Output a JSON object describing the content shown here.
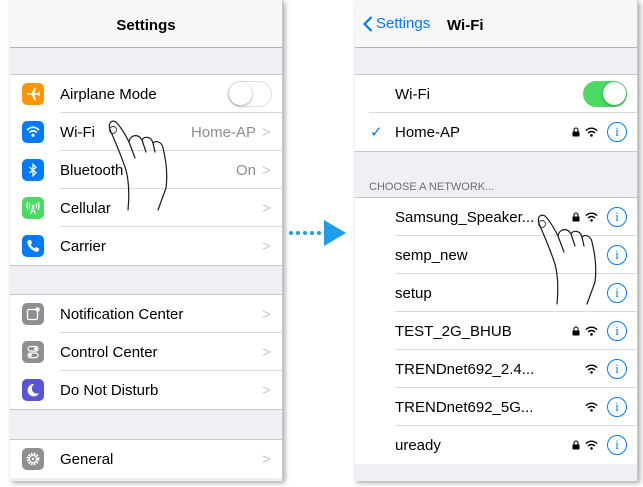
{
  "left": {
    "nav_title": "Settings",
    "rows": [
      {
        "label": "Airplane Mode",
        "icon": "airplane-icon",
        "color": "#ff9500",
        "control": "toggle-off"
      },
      {
        "label": "Wi-Fi",
        "icon": "wifi-icon",
        "color": "#007aff",
        "value": "Home-AP",
        "chevron": ">"
      },
      {
        "label": "Bluetooth",
        "icon": "bluetooth-icon",
        "color": "#007aff",
        "value": "On",
        "chevron": ">"
      },
      {
        "label": "Cellular",
        "icon": "cellular-icon",
        "color": "#4cd964",
        "chevron": ">"
      },
      {
        "label": "Carrier",
        "icon": "phone-icon",
        "color": "#007aff",
        "chevron": ">"
      },
      {
        "label": "Notification Center",
        "icon": "notification-center-icon",
        "color": "#8e8e93",
        "chevron": ">"
      },
      {
        "label": "Control Center",
        "icon": "control-center-icon",
        "color": "#8e8e93",
        "chevron": ">"
      },
      {
        "label": "Do Not Disturb",
        "icon": "moon-icon",
        "color": "#5856d6",
        "chevron": ">"
      },
      {
        "label": "General",
        "icon": "gear-icon",
        "color": "#8e8e93",
        "chevron": ">"
      }
    ]
  },
  "right": {
    "back_label": "Settings",
    "nav_title": "Wi-Fi",
    "wifi_label": "Wi-Fi",
    "wifi_on": true,
    "connected": "Home-AP",
    "section_header": "CHOOSE A NETWORK...",
    "networks": [
      {
        "name": "Samsung_Speaker...",
        "locked": true
      },
      {
        "name": "semp_new",
        "locked": false
      },
      {
        "name": "setup",
        "locked": false
      },
      {
        "name": "TEST_2G_BHUB",
        "locked": true
      },
      {
        "name": "TRENDnet692_2.4...",
        "locked": false
      },
      {
        "name": "TRENDnet692_5G...",
        "locked": false
      },
      {
        "name": "uready",
        "locked": true
      }
    ],
    "info_glyph": "i"
  },
  "arrow_color": "#1e9ee8"
}
